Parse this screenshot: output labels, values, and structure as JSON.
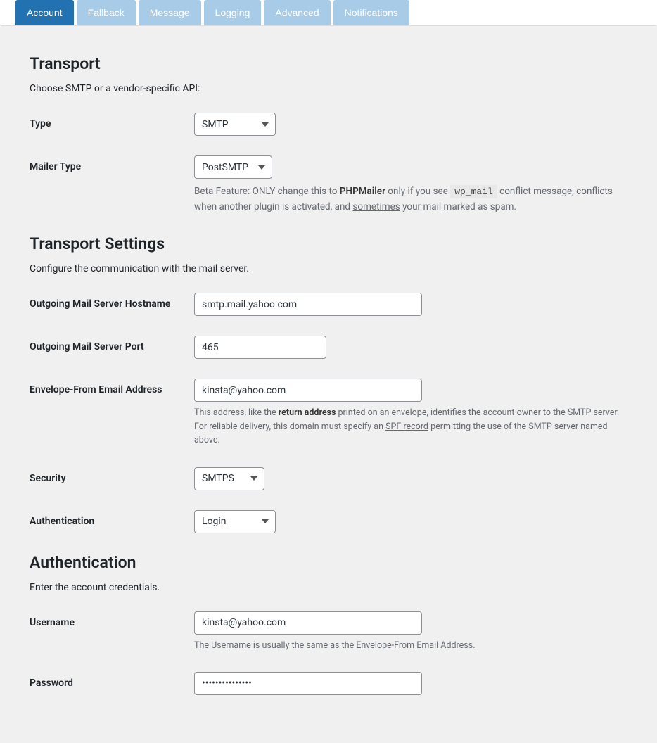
{
  "tabs": [
    {
      "label": "Account",
      "active": true
    },
    {
      "label": "Fallback"
    },
    {
      "label": "Message"
    },
    {
      "label": "Logging"
    },
    {
      "label": "Advanced"
    },
    {
      "label": "Notifications"
    }
  ],
  "transport": {
    "title": "Transport",
    "desc": "Choose SMTP or a vendor-specific API:",
    "type_label": "Type",
    "type_value": "SMTP",
    "mailer_label": "Mailer Type",
    "mailer_value": "PostSMTP",
    "mailer_help_prefix": "Beta Feature: ONLY change this to ",
    "mailer_help_bold": "PHPMailer",
    "mailer_help_mid": " only if you see ",
    "mailer_help_code": "wp_mail",
    "mailer_help_after_code": " conflict message, conflicts when another plugin is activated, and ",
    "mailer_help_link": "sometimes",
    "mailer_help_end": " your mail marked as spam."
  },
  "transport_settings": {
    "title": "Transport Settings",
    "desc": "Configure the communication with the mail server.",
    "hostname_label": "Outgoing Mail Server Hostname",
    "hostname_value": "smtp.mail.yahoo.com",
    "port_label": "Outgoing Mail Server Port",
    "port_value": "465",
    "envelope_label": "Envelope-From Email Address",
    "envelope_value": "kinsta@yahoo.com",
    "envelope_help_prefix": "This address, like the ",
    "envelope_help_bold": "return address",
    "envelope_help_mid": " printed on an envelope, identifies the account owner to the SMTP server. For reliable delivery, this domain must specify an ",
    "envelope_help_link": "SPF record",
    "envelope_help_end": " permitting the use of the SMTP server named above.",
    "security_label": "Security",
    "security_value": "SMTPS",
    "auth_label": "Authentication",
    "auth_value": "Login"
  },
  "authentication": {
    "title": "Authentication",
    "desc": "Enter the account credentials.",
    "username_label": "Username",
    "username_value": "kinsta@yahoo.com",
    "username_help": "The Username is usually the same as the Envelope-From Email Address.",
    "password_label": "Password",
    "password_value": "•••••••••••••••"
  }
}
